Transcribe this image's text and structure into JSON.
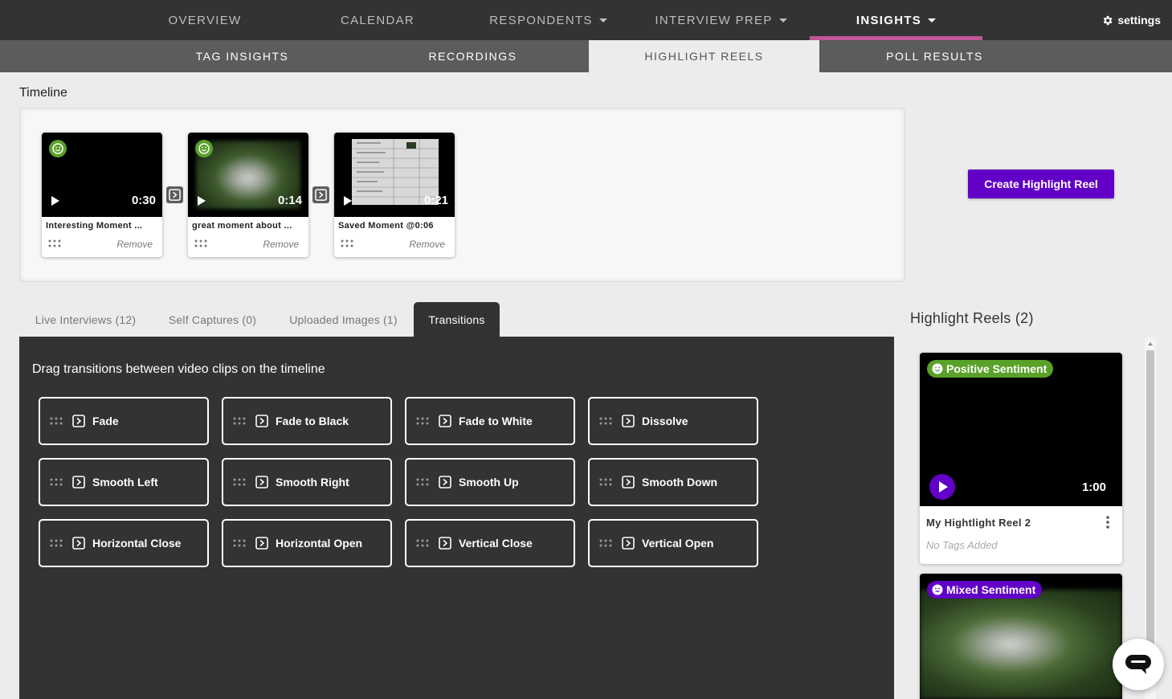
{
  "top_nav": {
    "items": [
      {
        "label": "OVERVIEW"
      },
      {
        "label": "CALENDAR"
      },
      {
        "label": "RESPONDENTS"
      },
      {
        "label": "INTERVIEW PREP"
      },
      {
        "label": "INSIGHTS"
      }
    ],
    "active": "INSIGHTS",
    "settings_label": "settings",
    "accent_color": "#c2569a"
  },
  "sub_nav": {
    "items": [
      {
        "label": "TAG INSIGHTS"
      },
      {
        "label": "RECORDINGS"
      },
      {
        "label": "HIGHLIGHT REELS"
      },
      {
        "label": "POLL RESULTS"
      }
    ],
    "active": "HIGHLIGHT REELS"
  },
  "timeline": {
    "title": "Timeline",
    "clips": [
      {
        "name": "Interesting Moment ...",
        "duration": "0:30",
        "remove_label": "Remove",
        "sentiment_icon": "smile-icon"
      },
      {
        "name": "great moment about ...",
        "duration": "0:14",
        "remove_label": "Remove",
        "sentiment_icon": "smile-icon"
      },
      {
        "name": "Saved Moment @0:06",
        "duration": "0:21",
        "remove_label": "Remove"
      }
    ]
  },
  "create_button_label": "Create Highlight Reel",
  "tabs": [
    {
      "label": "Live Interviews (12)"
    },
    {
      "label": "Self Captures (0)"
    },
    {
      "label": "Uploaded Images (1)"
    },
    {
      "label": "Transitions"
    }
  ],
  "active_tab": "Transitions",
  "transitions": {
    "instruction": "Drag transitions between video clips on the timeline",
    "items": [
      {
        "label": "Fade"
      },
      {
        "label": "Fade to Black"
      },
      {
        "label": "Fade to White"
      },
      {
        "label": "Dissolve"
      },
      {
        "label": "Smooth Left"
      },
      {
        "label": "Smooth Right"
      },
      {
        "label": "Smooth Up"
      },
      {
        "label": "Smooth Down"
      },
      {
        "label": "Horizontal Close"
      },
      {
        "label": "Horizontal Open"
      },
      {
        "label": "Vertical Close"
      },
      {
        "label": "Vertical Open"
      }
    ]
  },
  "highlight_reels": {
    "title": "Highlight Reels (2)",
    "reels": [
      {
        "sentiment": "Positive Sentiment",
        "sentiment_color": "#5aa129",
        "duration": "1:00",
        "name": "My Hightlight Reel 2",
        "tags": "No Tags Added"
      },
      {
        "sentiment": "Mixed Sentiment",
        "sentiment_color": "#6200c8"
      }
    ]
  },
  "colors": {
    "brand_purple": "#6200c8",
    "positive_green": "#5aa129",
    "dark_panel": "#333333"
  }
}
